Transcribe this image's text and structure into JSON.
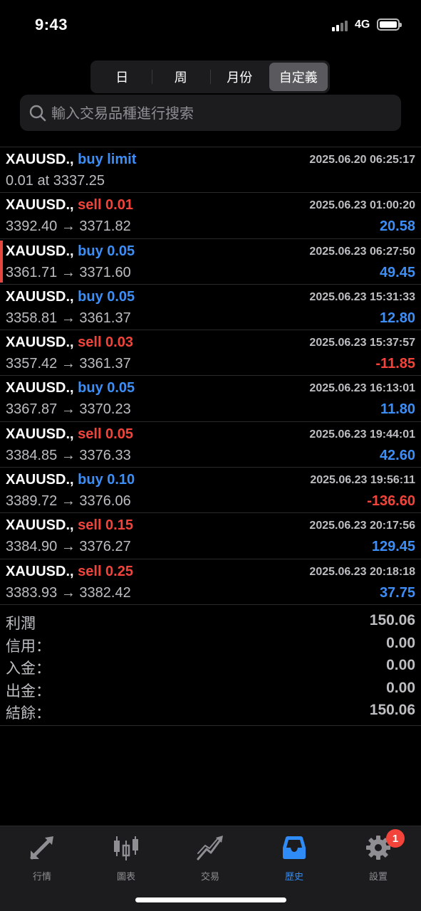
{
  "status": {
    "time": "9:43",
    "network": "4G"
  },
  "period_tabs": [
    {
      "label": "日",
      "active": false
    },
    {
      "label": "周",
      "active": false
    },
    {
      "label": "月份",
      "active": false
    },
    {
      "label": "自定義",
      "active": true
    }
  ],
  "search": {
    "placeholder": "輸入交易品種進行搜索",
    "value": ""
  },
  "deals": [
    {
      "symbol": "XAUUSD.,",
      "type": "buy limit",
      "side": "buy",
      "time": "2025.06.20 06:25:17",
      "prices": "0.01 at 3337.25",
      "profit": ""
    },
    {
      "symbol": "XAUUSD.,",
      "type": "sell 0.01",
      "side": "sell",
      "time": "2025.06.23 01:00:20",
      "prices": "3392.40 → 3371.82",
      "profit": "20.58",
      "sign": "pos"
    },
    {
      "symbol": "XAUUSD.,",
      "type": "buy 0.05",
      "side": "buy",
      "time": "2025.06.23 06:27:50",
      "prices": "3361.71 → 3371.60",
      "profit": "49.45",
      "sign": "pos",
      "marked": true
    },
    {
      "symbol": "XAUUSD.,",
      "type": "buy 0.05",
      "side": "buy",
      "time": "2025.06.23 15:31:33",
      "prices": "3358.81 → 3361.37",
      "profit": "12.80",
      "sign": "pos"
    },
    {
      "symbol": "XAUUSD.,",
      "type": "sell 0.03",
      "side": "sell",
      "time": "2025.06.23 15:37:57",
      "prices": "3357.42 → 3361.37",
      "profit": "-11.85",
      "sign": "neg"
    },
    {
      "symbol": "XAUUSD.,",
      "type": "buy 0.05",
      "side": "buy",
      "time": "2025.06.23 16:13:01",
      "prices": "3367.87 → 3370.23",
      "profit": "11.80",
      "sign": "pos"
    },
    {
      "symbol": "XAUUSD.,",
      "type": "sell 0.05",
      "side": "sell",
      "time": "2025.06.23 19:44:01",
      "prices": "3384.85 → 3376.33",
      "profit": "42.60",
      "sign": "pos"
    },
    {
      "symbol": "XAUUSD.,",
      "type": "buy 0.10",
      "side": "buy",
      "time": "2025.06.23 19:56:11",
      "prices": "3389.72 → 3376.06",
      "profit": "-136.60",
      "sign": "neg"
    },
    {
      "symbol": "XAUUSD.,",
      "type": "sell 0.15",
      "side": "sell",
      "time": "2025.06.23 20:17:56",
      "prices": "3384.90 → 3376.27",
      "profit": "129.45",
      "sign": "pos"
    },
    {
      "symbol": "XAUUSD.,",
      "type": "sell 0.25",
      "side": "sell",
      "time": "2025.06.23 20:18:18",
      "prices": "3383.93 → 3382.42",
      "profit": "37.75",
      "sign": "pos"
    }
  ],
  "summary": [
    {
      "label": "利潤",
      "value": "150.06"
    },
    {
      "label": "信用：",
      "value": "0.00"
    },
    {
      "label": "入金：",
      "value": "0.00"
    },
    {
      "label": "出金：",
      "value": "0.00"
    },
    {
      "label": "結餘：",
      "value": "150.06"
    }
  ],
  "tabbar": [
    {
      "label": "行情",
      "icon": "quotes-arrows-icon",
      "active": false
    },
    {
      "label": "圖表",
      "icon": "candlestick-chart-icon",
      "active": false
    },
    {
      "label": "交易",
      "icon": "trade-trend-icon",
      "active": false
    },
    {
      "label": "歷史",
      "icon": "history-inbox-icon",
      "active": true
    },
    {
      "label": "設置",
      "icon": "settings-gear-icon",
      "active": false,
      "badge": "1"
    }
  ],
  "colors": {
    "buy": "#3d8ef7",
    "sell": "#f2443a",
    "active_tab": "#2f8bf5",
    "background": "#000000"
  }
}
